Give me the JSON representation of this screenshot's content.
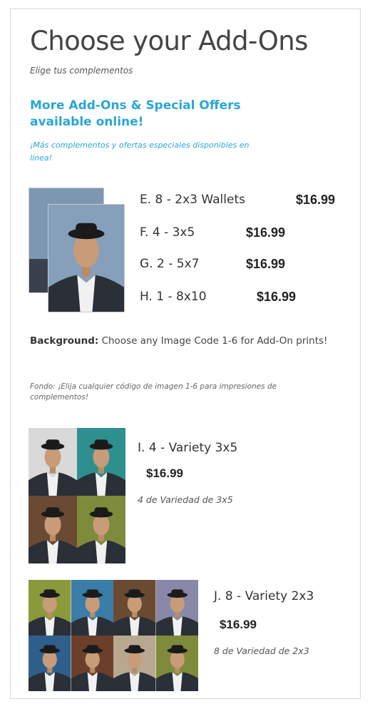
{
  "header": {
    "title": "Choose your Add-Ons",
    "subtitle": "Elige tus complementos"
  },
  "promo": {
    "headline": "More Add-Ons & Special Offers available online!",
    "subline": "¡Más complementos y ofertas especiales disponibles en línea!"
  },
  "packages": [
    {
      "label": "E. 8 - 2x3 Wallets",
      "price": "$16.99"
    },
    {
      "label": "F. 4 - 3x5",
      "price": "$16.99"
    },
    {
      "label": "G. 2 - 5x7",
      "price": "$16.99"
    },
    {
      "label": "H. 1 - 8x10",
      "price": "$16.99"
    }
  ],
  "background_note": {
    "label": "Background:",
    "text": "Choose any Image Code 1-6 for Add-On prints!",
    "spanish": "Fondo: ¡Elija cualquier código de imagen 1-6 para impresiones de complementos!"
  },
  "variety": [
    {
      "label": "I. 4 - Variety 3x5",
      "price": "$16.99",
      "spanish": "4 de Variedad de 3x5",
      "backgrounds": [
        "#d9d9d9",
        "#2e8f8f",
        "#6b4a34",
        "#7d8b3a"
      ]
    },
    {
      "label": "J. 8 - Variety 2x3",
      "price": "$16.99",
      "spanish": "8 de Variedad de 2x3",
      "backgrounds": [
        "#8a9a3a",
        "#3a7ea8",
        "#6b4a34",
        "#8a88a8",
        "#2f5f8a",
        "#6b3f2a",
        "#b8a890",
        "#7d8b3a"
      ]
    }
  ],
  "colors": {
    "accent": "#2ba6d6",
    "text": "#444444"
  }
}
